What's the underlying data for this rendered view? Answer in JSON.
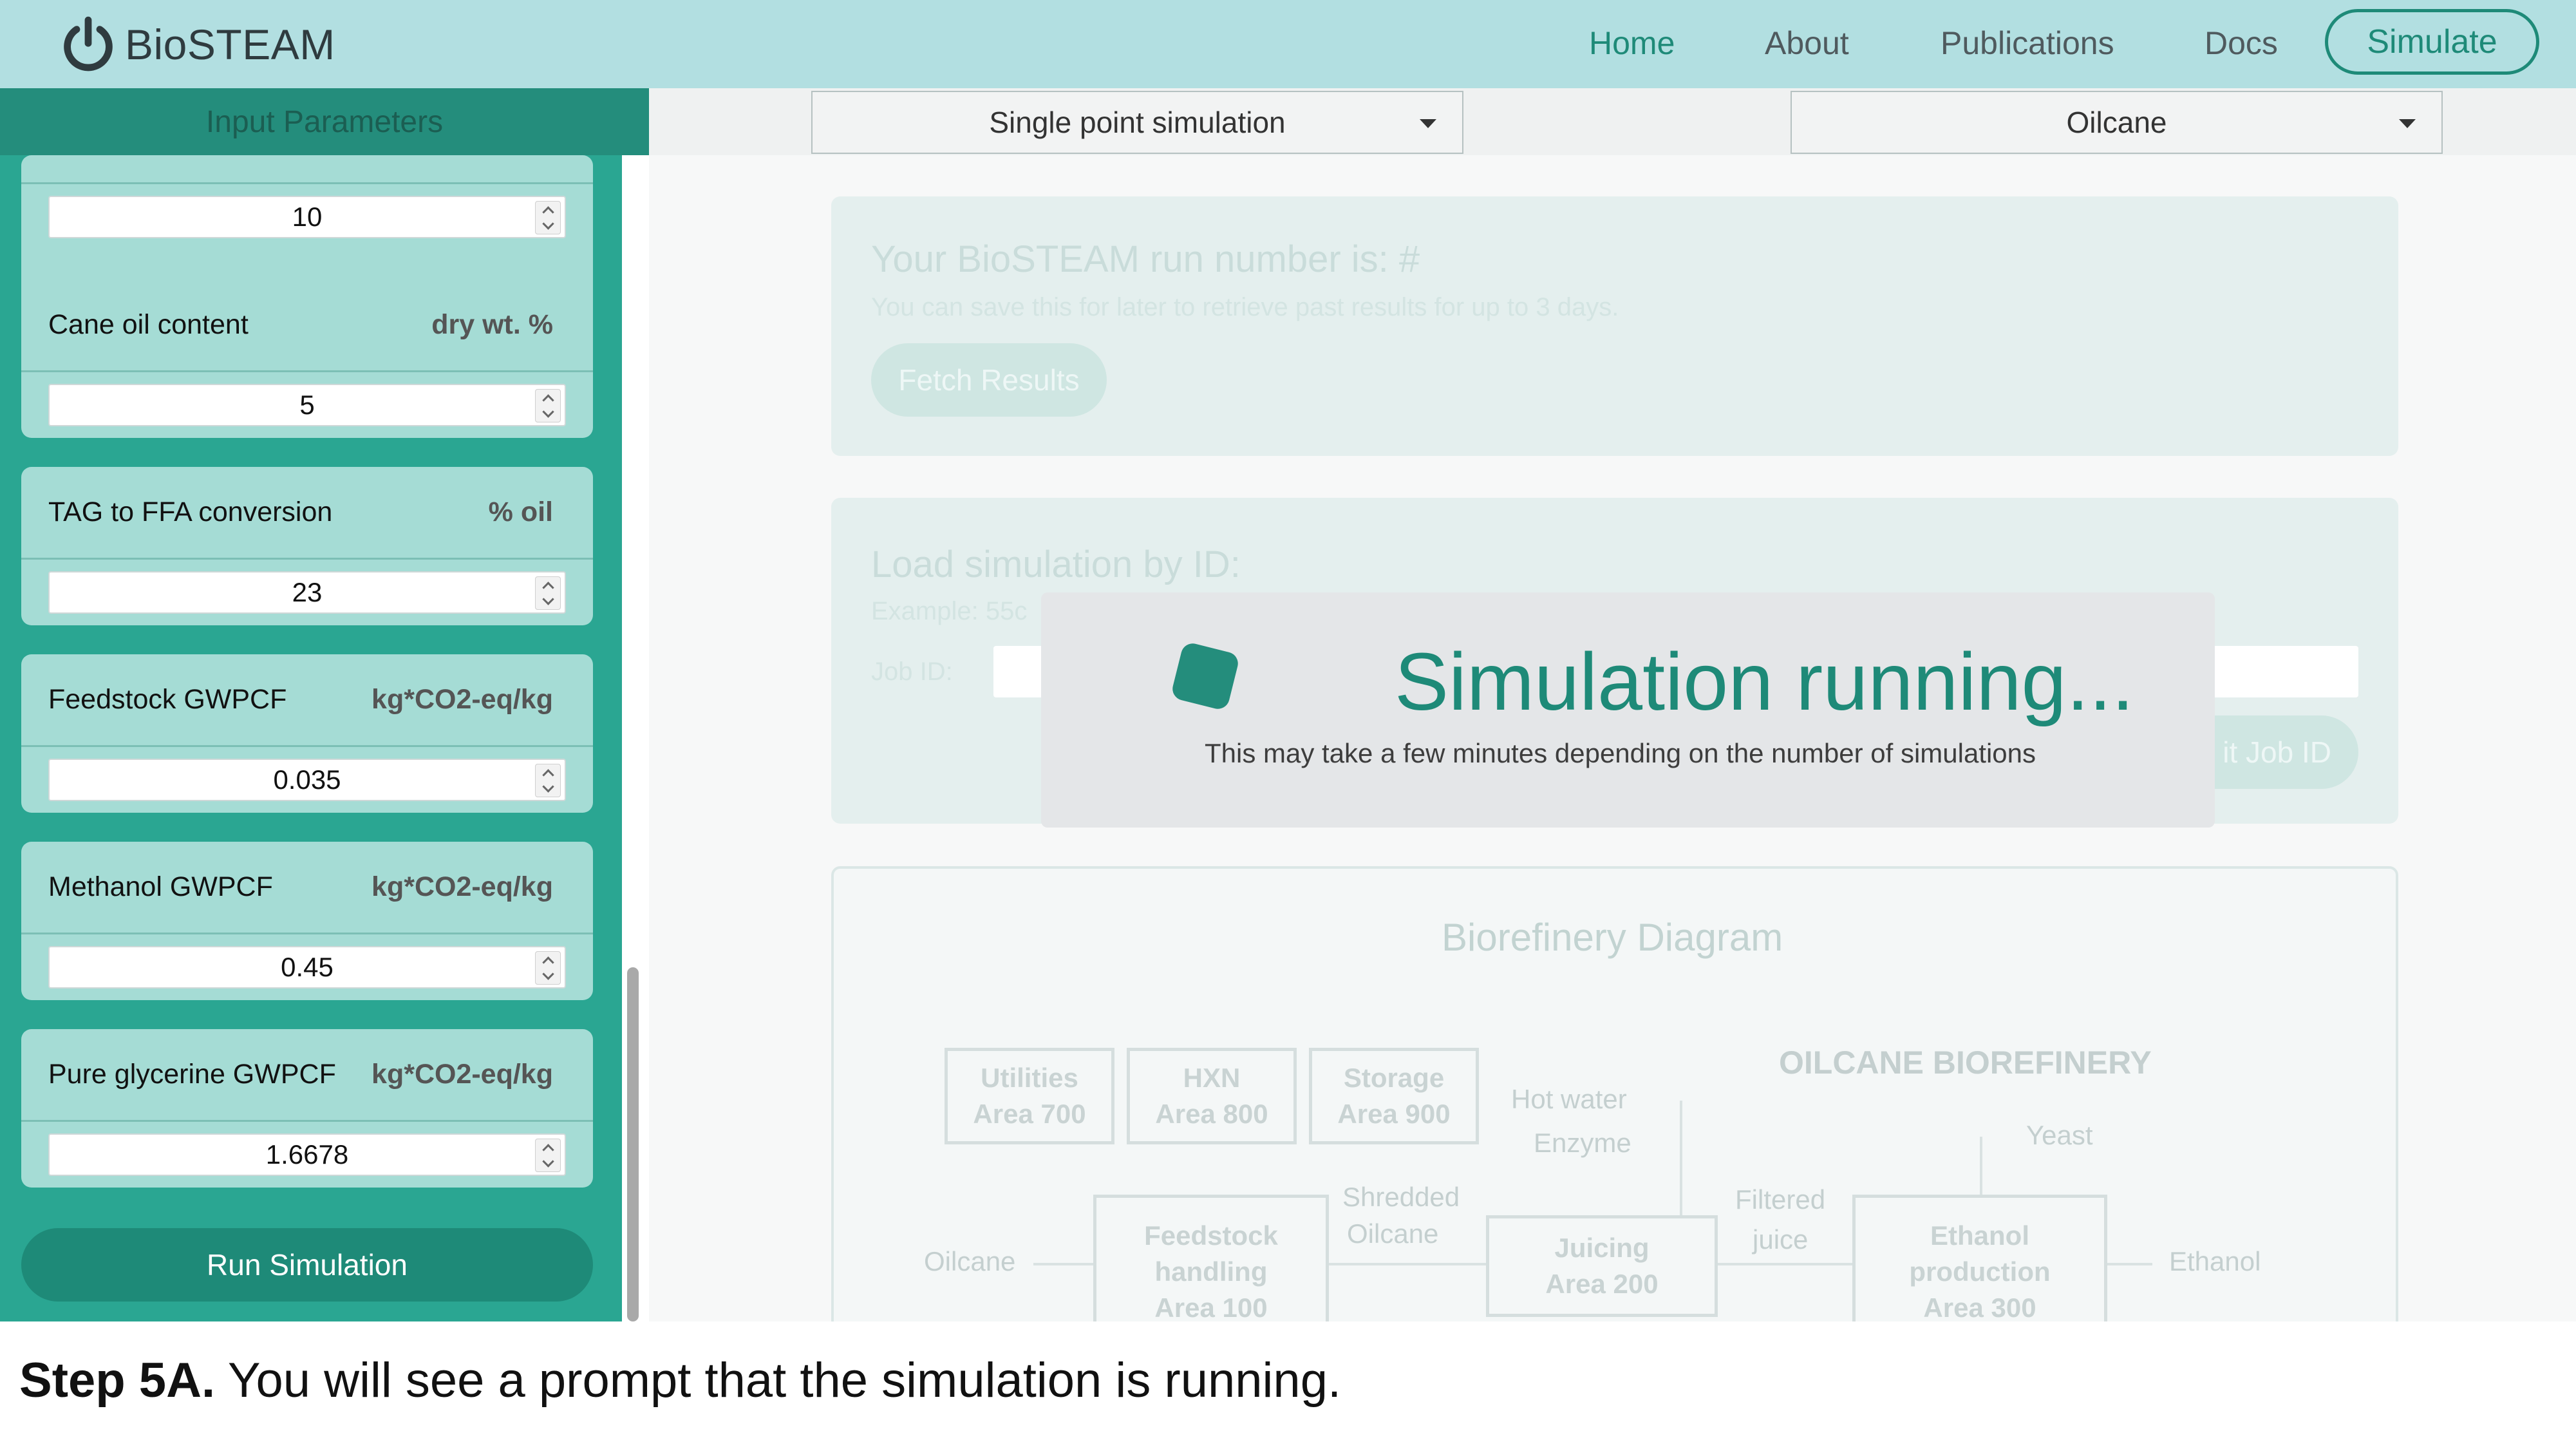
{
  "navbar": {
    "brand": "BioSTEAM",
    "links": [
      "Home",
      "About",
      "Publications",
      "Docs"
    ],
    "active": "Home",
    "simulate": "Simulate",
    "accent": "#1e8a78"
  },
  "sidebar": {
    "header": "Input Parameters",
    "params": [
      {
        "label": "",
        "unit": "",
        "value": "10"
      },
      {
        "label": "Cane oil content",
        "unit": "dry wt. %",
        "value": "5"
      },
      {
        "label": "TAG to FFA conversion",
        "unit": "% oil",
        "value": "23"
      },
      {
        "label": "Feedstock GWPCF",
        "unit": "kg*CO2-eq/kg",
        "value": "0.035"
      },
      {
        "label": "Methanol GWPCF",
        "unit": "kg*CO2-eq/kg",
        "value": "0.45"
      },
      {
        "label": "Pure glycerine GWPCF",
        "unit": "kg*CO2-eq/kg",
        "value": "1.6678"
      }
    ],
    "run_button": "Run Simulation"
  },
  "main": {
    "mode_select": "Single point simulation",
    "feedstock_select": "Oilcane",
    "run_panel": {
      "title": "Your BioSTEAM run number is: #",
      "subtitle": "You can save this for later to retrieve past results for up to 3 days.",
      "fetch_button": "Fetch Results"
    },
    "load_panel": {
      "title": "Load simulation by ID:",
      "example": "Example: 55c",
      "job_label": "Job ID:",
      "submit_button": "it Job ID"
    },
    "diagram": {
      "title": "Biorefinery Diagram",
      "heading": "OILCANE BIOREFINERY",
      "boxes": [
        {
          "line1": "Utilities",
          "line2": "Area 700"
        },
        {
          "line1": "HXN",
          "line2": "Area 800"
        },
        {
          "line1": "Storage",
          "line2": "Area 900"
        }
      ],
      "feedstock_box": {
        "line1": "Feedstock",
        "line2": "handling",
        "line3": "Area 100"
      },
      "juicing_box": {
        "line1": "Juicing",
        "line2": "Area 200"
      },
      "ethanol_box": {
        "line1": "Ethanol",
        "line2": "production",
        "line3": "Area 300"
      },
      "streams": {
        "oilcane": "Oilcane",
        "shredded1": "Shredded",
        "shredded2": "Oilcane",
        "hot_water": "Hot water",
        "enzyme": "Enzyme",
        "filtered1": "Filtered",
        "filtered2": "juice",
        "yeast": "Yeast",
        "ethanol": "Ethanol"
      }
    }
  },
  "modal": {
    "title": "Simulation running...",
    "subtitle": "This may take a few minutes depending on the number of simulations"
  },
  "caption": {
    "step": "Step 5A.",
    "text": " You will see a prompt that the simulation is running."
  }
}
